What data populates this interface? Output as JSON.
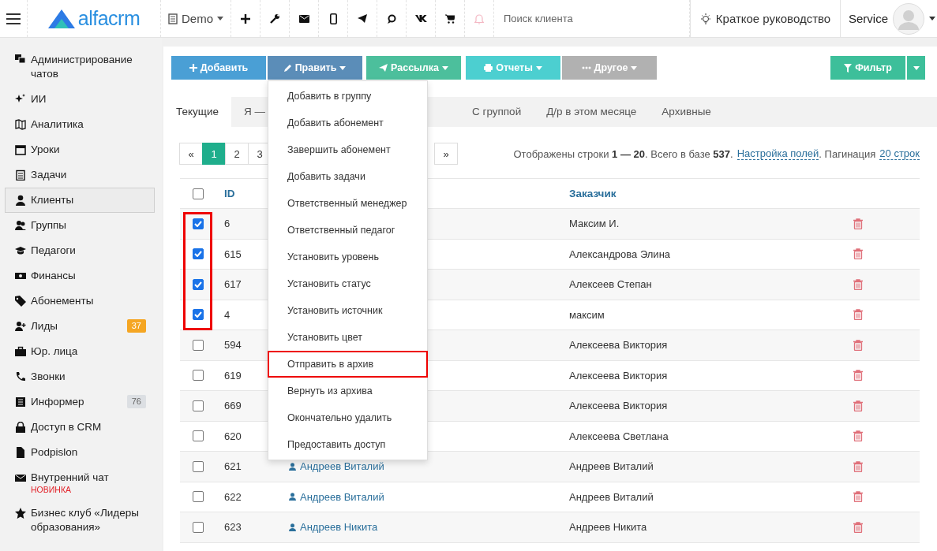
{
  "topbar": {
    "logo": "alfacrm",
    "branch": "Demo",
    "search": {
      "placeholder": "Поиск клиента"
    },
    "guide": "Краткое руководство",
    "user": "Service"
  },
  "sidebar": {
    "items": [
      {
        "label": "Администрирование чатов",
        "selected": false
      },
      {
        "label": "ИИ",
        "selected": false
      },
      {
        "label": "Аналитика",
        "selected": false
      },
      {
        "label": "Уроки",
        "selected": false
      },
      {
        "label": "Задачи",
        "selected": false
      },
      {
        "label": "Клиенты",
        "selected": true
      },
      {
        "label": "Группы",
        "selected": false
      },
      {
        "label": "Педагоги",
        "selected": false
      },
      {
        "label": "Финансы",
        "selected": false
      },
      {
        "label": "Абонементы",
        "selected": false
      },
      {
        "label": "Лиды",
        "selected": false,
        "badge": {
          "text": "37",
          "color": "#f5a623"
        }
      },
      {
        "label": "Юр. лица",
        "selected": false
      },
      {
        "label": "Звонки",
        "selected": false
      },
      {
        "label": "Информер",
        "selected": false,
        "badge": {
          "text": "76",
          "color": "#dcdfe3"
        }
      },
      {
        "label": "Доступ в CRM",
        "selected": false
      },
      {
        "label": "Podpislon",
        "selected": false
      },
      {
        "label": "Внутренний чат",
        "selected": false,
        "note": "НОВИНКА"
      },
      {
        "label": "Бизнес клуб «Лидеры образования»",
        "selected": false
      }
    ]
  },
  "toolbar": {
    "buttons": [
      {
        "label": "Добавить",
        "color": "#4a9fd5",
        "disabled": false,
        "caret": false
      },
      {
        "label": "Править",
        "color": "#5b8db8",
        "disabled": false,
        "caret": true
      },
      {
        "label": "Рассылка",
        "color": "#4cbf9c",
        "disabled": false,
        "caret": true
      },
      {
        "label": "Отчеты",
        "color": "#4ccfd0",
        "disabled": false,
        "caret": true
      },
      {
        "label": "Другое",
        "color": "#a9a9a9",
        "disabled": true,
        "caret": true
      }
    ],
    "filter": "Фильтр"
  },
  "edit_menu": {
    "items": [
      {
        "label": "Добавить в группу",
        "highlighted": false
      },
      {
        "label": "Добавить абонемент",
        "highlighted": false
      },
      {
        "label": "Завершить абонемент",
        "highlighted": false
      },
      {
        "label": "Добавить задачи",
        "highlighted": false
      },
      {
        "label": "Ответственный менеджер",
        "highlighted": false
      },
      {
        "label": "Ответственный педагог",
        "highlighted": false
      },
      {
        "label": "Установить уровень",
        "highlighted": false
      },
      {
        "label": "Установить статус",
        "highlighted": false
      },
      {
        "label": "Установить источник",
        "highlighted": false
      },
      {
        "label": "Установить цвет",
        "highlighted": false
      },
      {
        "label": "Отправить в архив",
        "highlighted": true
      },
      {
        "label": "Вернуть из архива",
        "highlighted": false
      },
      {
        "label": "Окончательно удалить",
        "highlighted": false
      },
      {
        "label": "Предоставить доступ",
        "highlighted": false
      }
    ]
  },
  "tabs": [
    {
      "label": "Текущие",
      "selected": true
    },
    {
      "label": "Я —",
      "selected": false
    },
    {
      "label": "С группой",
      "selected": false
    },
    {
      "label": "Д/р в этом месяце",
      "selected": false
    },
    {
      "label": "Архивные",
      "selected": false
    }
  ],
  "pagination": {
    "prev": "«",
    "pages": [
      {
        "label": "1",
        "selected": true
      },
      {
        "label": "2",
        "selected": false
      },
      {
        "label": "3",
        "selected": false
      }
    ],
    "next": "»"
  },
  "summary": {
    "text": "Отображены строки **1 — 20**. Всего в базе **537**.",
    "fields_link": "Настройка полей",
    "pagination_label": ". Пагинация",
    "pagination_link": "20 строк"
  },
  "table": {
    "columns": [
      "ID",
      "Заказчик"
    ],
    "all_checked": false,
    "rows": [
      {
        "id": "6",
        "checked": true,
        "annotated": true,
        "customer": "Максим И."
      },
      {
        "id": "615",
        "checked": true,
        "annotated": true,
        "customer": "Александрова Элина"
      },
      {
        "id": "617",
        "checked": true,
        "annotated": true,
        "customer": "Алексеев Степан"
      },
      {
        "id": "4",
        "checked": true,
        "annotated": true,
        "customer": "максим"
      },
      {
        "id": "594",
        "checked": false,
        "annotated": false,
        "customer": "Алексеева Виктория"
      },
      {
        "id": "619",
        "checked": false,
        "annotated": false,
        "customer": "Алексеева Виктория"
      },
      {
        "id": "669",
        "checked": false,
        "annotated": false,
        "customer": "Алексеева Виктория"
      },
      {
        "id": "620",
        "checked": false,
        "annotated": false,
        "customer": "Алексеева Светлана"
      },
      {
        "id": "621",
        "checked": false,
        "annotated": false,
        "client": "Андреев Виталий",
        "customer": "Андреев Виталий"
      },
      {
        "id": "622",
        "checked": false,
        "annotated": false,
        "client": "Андреев Виталий",
        "customer": "Андреев Виталий"
      },
      {
        "id": "623",
        "checked": false,
        "annotated": false,
        "client": "Андреев Никита",
        "customer": "Андреев Никита"
      }
    ]
  }
}
